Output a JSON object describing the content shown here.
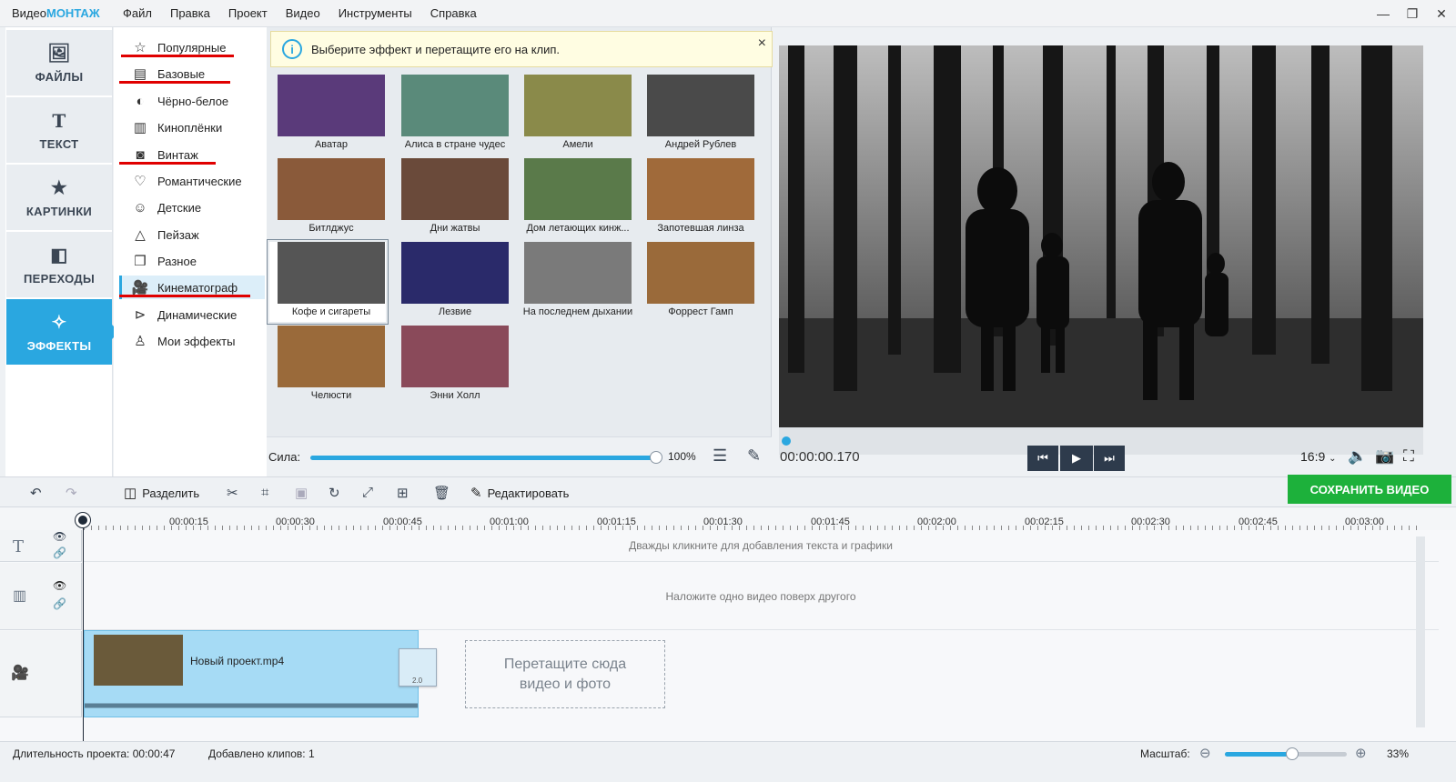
{
  "menubar": {
    "logo_prefix": "Видео",
    "logo_brand": "МОНТАЖ",
    "items": [
      "Файл",
      "Правка",
      "Проект",
      "Видео",
      "Инструменты",
      "Справка"
    ]
  },
  "left_tabs": [
    {
      "label": "ФАЙЛЫ",
      "icon": "image-icon"
    },
    {
      "label": "ТЕКСТ",
      "icon": "text-icon"
    },
    {
      "label": "КАРТИНКИ",
      "icon": "star-icon"
    },
    {
      "label": "ПЕРЕХОДЫ",
      "icon": "transitions-icon"
    },
    {
      "label": "ЭФФЕКТЫ",
      "icon": "magic-wand-icon",
      "active": true
    }
  ],
  "categories": [
    "Популярные",
    "Базовые",
    "Чёрно-белое",
    "Киноплёнки",
    "Винтаж",
    "Романтические",
    "Детские",
    "Пейзаж",
    "Разное",
    "Кинематограф",
    "Динамические",
    "Мои эффекты"
  ],
  "info": {
    "text": "Выберите эффект и перетащите его на клип.",
    "close": "×"
  },
  "effects": [
    "Аватар",
    "Алиса в стране чудес",
    "Амели",
    "Андрей Рублев",
    "Битлджус",
    "Дни жатвы",
    "Дом летающих кинж...",
    "Запотевшая линза",
    "Кофе и сигареты",
    "Лезвие",
    "На последнем дыхании",
    "Форрест Гамп",
    "Челюсти",
    "Энни Холл"
  ],
  "strength": {
    "label": "Сила:",
    "value": "100%",
    "fraction": 1.0
  },
  "preview": {
    "time": "00:00:00.170",
    "aspect": "16:9"
  },
  "toolbar": {
    "split": "Разделить",
    "edit": "Редактировать",
    "save": "СОХРАНИТЬ ВИДЕО"
  },
  "ruler": [
    "00:00:15",
    "00:00:30",
    "00:00:45",
    "00:01:00",
    "00:01:15",
    "00:01:30",
    "00:01:45",
    "00:02:00",
    "00:02:15",
    "00:02:30",
    "00:02:45",
    "00:03:00"
  ],
  "tracks": {
    "text_hint": "Дважды кликните для добавления текста и графики",
    "overlay_hint": "Наложите одно видео поверх другого",
    "clip_name": "Новый проект.mp4",
    "transition_value": "2.0",
    "drop_hint": "Перетащите сюда видео и фото"
  },
  "status": {
    "duration_label": "Длительность проекта:",
    "duration": "00:00:47",
    "clips_label": "Добавлено клипов:",
    "clips": "1",
    "zoom_label": "Масштаб:",
    "zoom": "33%",
    "zoom_fraction": 0.55
  },
  "colors": {
    "accent": "#2aa7e0",
    "save": "#1db13b",
    "underline": "#e00000"
  }
}
